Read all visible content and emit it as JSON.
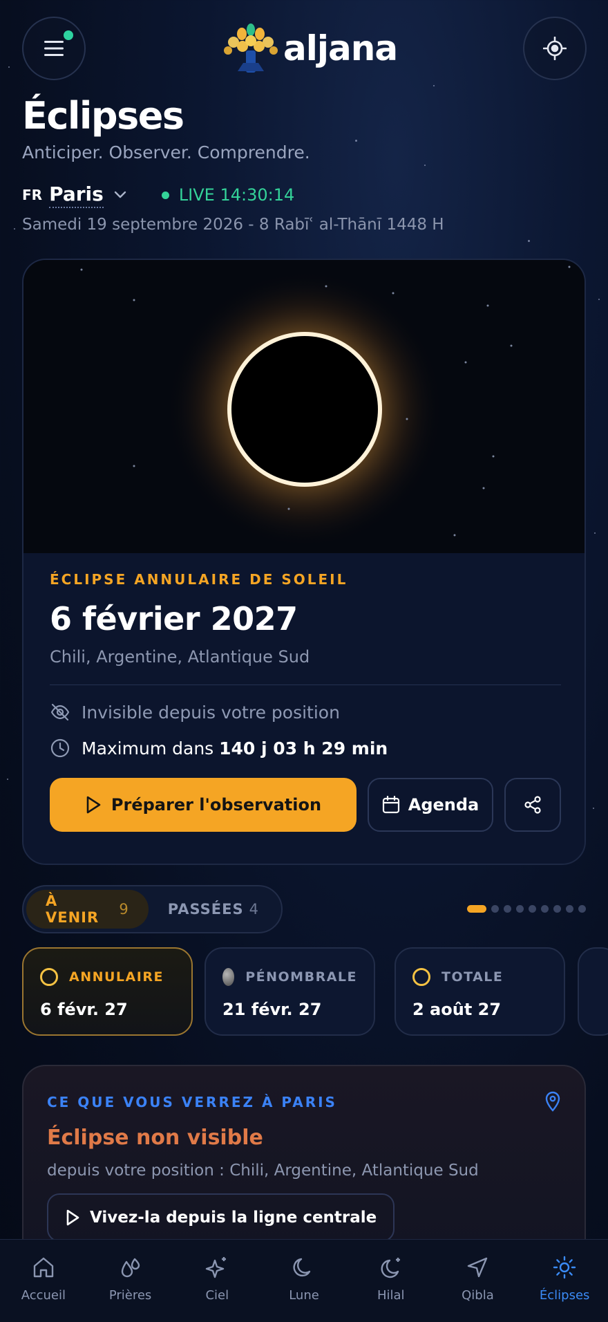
{
  "header": {
    "brand": "aljana",
    "menu_icon": "menu-icon",
    "locate_icon": "crosshair-icon"
  },
  "page": {
    "title": "Éclipses",
    "subtitle": "Anticiper. Observer. Comprendre.",
    "flag": "FR",
    "city": "Paris",
    "live_label": "LIVE 14:30:14",
    "date_line": "Samedi 19 septembre 2026 - 8 Rabīʿ al-Thānī 1448 H"
  },
  "hero": {
    "eyebrow": "ÉCLIPSE ANNULAIRE DE SOLEIL",
    "date": "6 février 2027",
    "region": "Chili, Argentine, Atlantique Sud",
    "visibility": "Invisible depuis votre position",
    "countdown_prefix": "Maximum dans",
    "countdown_value": "140 j 03 h 29 min",
    "primary_button": "Préparer l'observation",
    "agenda_button": "Agenda"
  },
  "tabs": {
    "upcoming_label": "À VENIR",
    "upcoming_count": "9",
    "past_label": "PASSÉES",
    "past_count": "4",
    "page_dots": 9,
    "active_dot": 0
  },
  "chips": [
    {
      "type": "ANNULAIRE",
      "date": "6 févr. 27",
      "icon": "ring-icon",
      "selected": true
    },
    {
      "type": "PÉNOMBRALE",
      "date": "21 févr. 27",
      "icon": "penumbral-icon",
      "selected": false
    },
    {
      "type": "TOTALE",
      "date": "2 août 27",
      "icon": "ring-icon",
      "selected": false
    }
  ],
  "visibility_card": {
    "eyebrow": "CE QUE VOUS VERREZ À PARIS",
    "title": "Éclipse non visible",
    "subtitle": "depuis votre position : Chili, Argentine, Atlantique Sud",
    "button": "Vivez-la depuis la ligne centrale"
  },
  "nav": [
    {
      "label": "Accueil",
      "icon": "home-icon",
      "active": false
    },
    {
      "label": "Prières",
      "icon": "prayer-icon",
      "active": false
    },
    {
      "label": "Ciel",
      "icon": "sparkle-icon",
      "active": false
    },
    {
      "label": "Lune",
      "icon": "moon-icon",
      "active": false
    },
    {
      "label": "Hilal",
      "icon": "crescent-star-icon",
      "active": false
    },
    {
      "label": "Qibla",
      "icon": "navigation-icon",
      "active": false
    },
    {
      "label": "Éclipses",
      "icon": "sun-icon",
      "active": true
    }
  ],
  "colors": {
    "accent": "#f5a524",
    "live": "#34d399",
    "link_blue": "#3b82f6",
    "warning": "#e07a48"
  }
}
